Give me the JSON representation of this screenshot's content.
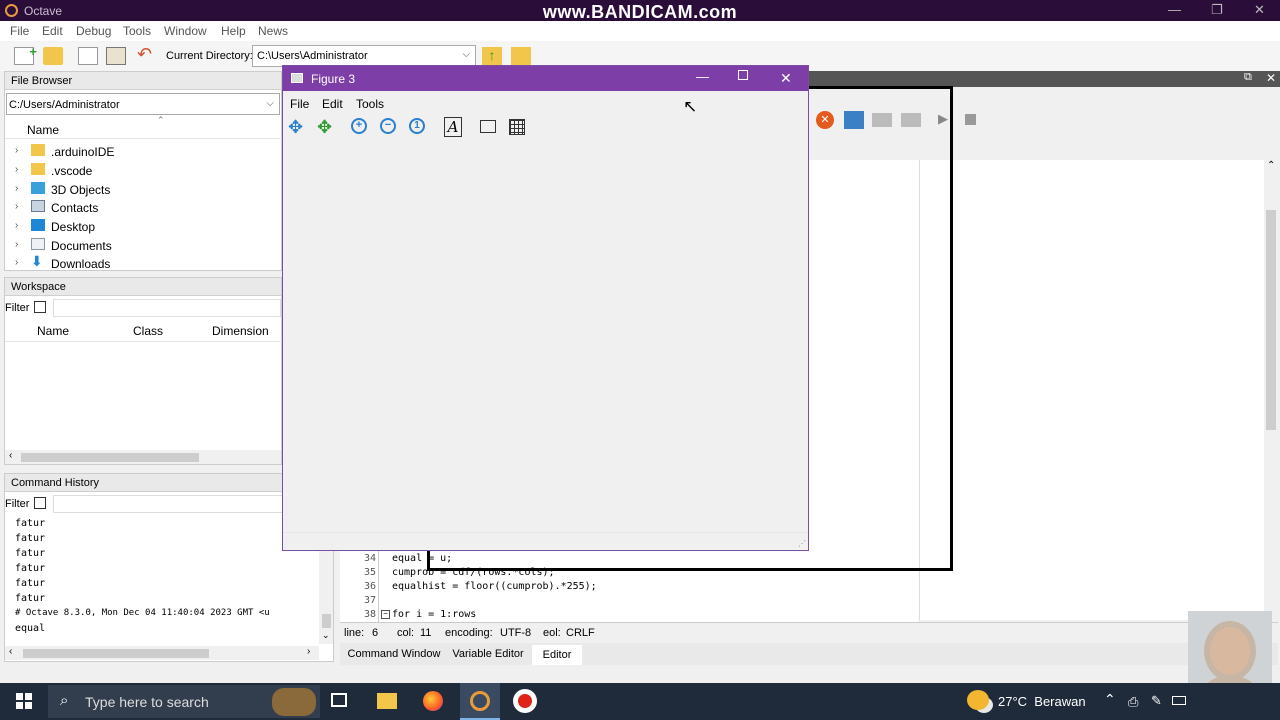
{
  "window": {
    "title": "Octave",
    "watermark": "www.BANDICAM.com"
  },
  "menu": [
    "File",
    "Edit",
    "Debug",
    "Tools",
    "Window",
    "Help",
    "News"
  ],
  "toolbar": {
    "current_dir_label": "Current Directory:",
    "current_dir_value": "C:\\Users\\Administrator"
  },
  "file_browser": {
    "title": "File Browser",
    "path": "C:/Users/Administrator",
    "column": "Name",
    "items": [
      {
        "label": ".arduinoIDE",
        "icon": "folder-icon"
      },
      {
        "label": ".vscode",
        "icon": "folder-icon"
      },
      {
        "label": "3D Objects",
        "icon": "3d-objects-icon"
      },
      {
        "label": "Contacts",
        "icon": "contacts-icon"
      },
      {
        "label": "Desktop",
        "icon": "desktop-icon"
      },
      {
        "label": "Documents",
        "icon": "documents-icon"
      },
      {
        "label": "Downloads",
        "icon": "downloads-icon"
      }
    ]
  },
  "workspace": {
    "title": "Workspace",
    "filter_label": "Filter",
    "columns": [
      "Name",
      "Class",
      "Dimension"
    ]
  },
  "command_history": {
    "title": "Command History",
    "filter_label": "Filter",
    "lines": [
      "fatur",
      "fatur",
      "fatur",
      "fatur",
      "fatur",
      "fatur",
      "# Octave 8.3.0, Mon Dec 04 11:40:04 2023 GMT <u",
      "equal"
    ]
  },
  "editor": {
    "lines": [
      {
        "num": "34",
        "code": "equal = u;"
      },
      {
        "num": "35",
        "code": "cumprob = cdf/(rows.*cols);"
      },
      {
        "num": "36",
        "code": "equalhist = floor((cumprob).*255);"
      },
      {
        "num": "37",
        "code": ""
      },
      {
        "num": "38",
        "code": "for i = 1:rows"
      }
    ],
    "status": {
      "line_label": "line:",
      "line": "6",
      "col_label": "col:",
      "col": "11",
      "enc_label": "encoding:",
      "enc": "UTF-8",
      "eol_label": "eol:",
      "eol": "CRLF"
    },
    "tabs": [
      "Command Window",
      "Variable Editor",
      "Editor"
    ]
  },
  "figure": {
    "title": "Figure 3",
    "menu": [
      "File",
      "Edit",
      "Tools"
    ]
  },
  "taskbar": {
    "search_placeholder": "Type here to search",
    "weather": "27°C  Berawan"
  }
}
